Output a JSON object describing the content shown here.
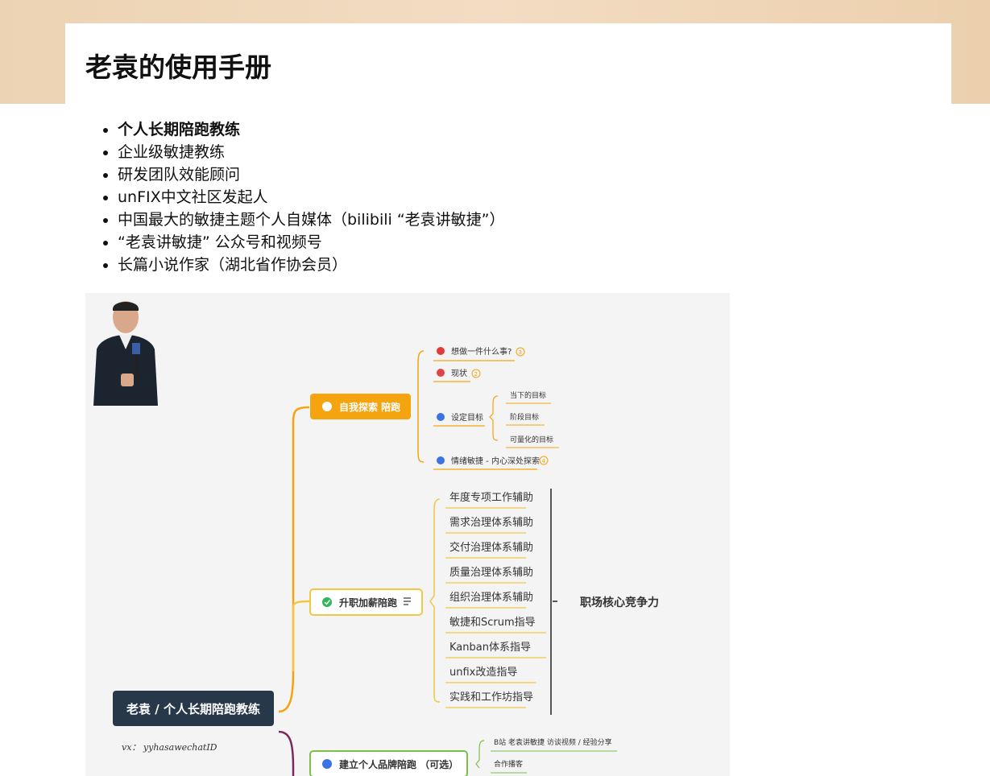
{
  "page": {
    "title": "老袁的使用手册"
  },
  "roles": [
    "个人长期陪跑教练",
    "企业级敏捷教练",
    "研发团队效能顾问",
    "unFIX中文社区发起人",
    "中国最大的敏捷主题个人自媒体（bilibili “老袁讲敏捷”）",
    "“老袁讲敏捷” 公众号和视频号",
    "长篇小说作家（湖北省作协会员）"
  ],
  "mindmap": {
    "person": {
      "name_label": "老袁 / 个人长期陪跑教练",
      "wechat": "vx： yyhasawechatID"
    },
    "branch1": {
      "label": "自我探索 陪跑",
      "color": "#f5a30f",
      "children": [
        {
          "label": "想做一件什么事?",
          "badge": "3"
        },
        {
          "label": "现状",
          "badge": "2"
        },
        {
          "label": "设定目标",
          "sub": [
            "当下的目标",
            "阶段目标",
            "可量化的目标"
          ]
        },
        {
          "label": "情绪敏捷 - 内心深处探索",
          "badge": "4"
        }
      ]
    },
    "branch2": {
      "label": "升职加薪陪跑",
      "color": "#f2c744",
      "items": [
        "年度专项工作辅助",
        "需求治理体系辅助",
        "交付治理体系辅助",
        "质量治理体系辅助",
        "组织治理体系辅助",
        "敏捷和Scrum指导",
        "Kanban体系指导",
        "unfix改造指导",
        "实践和工作坊指导"
      ],
      "summary": "职场核心竞争力"
    },
    "branch3": {
      "label": "建立个人品牌陪跑 （可选）",
      "color": "#7cc04b",
      "children": [
        "B站 老袁讲敏捷 访谈视频 / 经验分享",
        "合作播客"
      ]
    }
  },
  "colors": {
    "banner": "#ecd3b3",
    "name_box": "#28384b",
    "orange": "#f5a30f",
    "yellow": "#f2c744",
    "green": "#7cc04b",
    "purple": "#7a2a5a"
  }
}
